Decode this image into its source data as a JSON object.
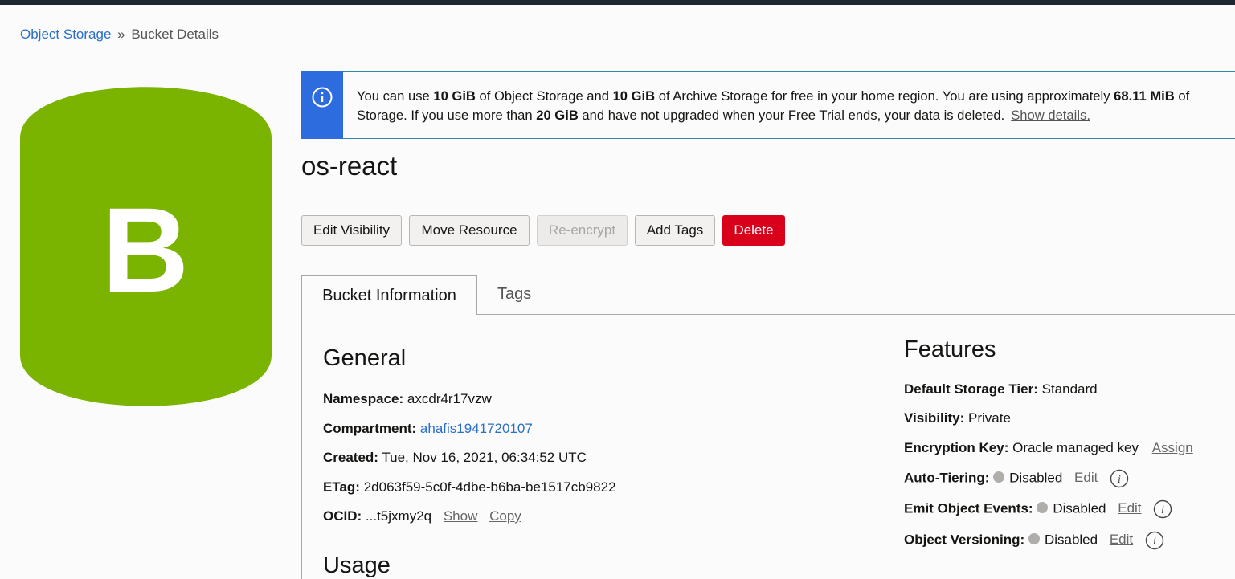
{
  "breadcrumb": {
    "root": "Object Storage",
    "separator": "»",
    "current": "Bucket Details"
  },
  "icon": {
    "letter": "B",
    "color": "#7ab300",
    "name": "bucket-icon"
  },
  "banner": {
    "p1": "You can use ",
    "b1": "10 GiB",
    "p2": " of Object Storage and ",
    "b2": "10 GiB",
    "p3": " of Archive Storage for free in your home region. You are using approximately ",
    "b3": "68.11 MiB",
    "p4": " of",
    "p5": "Storage. If you use more than ",
    "b4": "20 GiB",
    "p6": " and have not upgraded when your Free Trial ends, your data is deleted.",
    "link": "Show details."
  },
  "title": "os-react",
  "actions": {
    "edit_visibility": "Edit Visibility",
    "move_resource": "Move Resource",
    "re_encrypt": "Re-encrypt",
    "add_tags": "Add Tags",
    "delete": "Delete"
  },
  "tabs": {
    "bucket_information": "Bucket Information",
    "tags": "Tags"
  },
  "general": {
    "heading": "General",
    "namespace_label": "Namespace:",
    "namespace": "axcdr4r17vzw",
    "compartment_label": "Compartment:",
    "compartment": "ahafis1941720107",
    "created_label": "Created:",
    "created": "Tue, Nov 16, 2021, 06:34:52 UTC",
    "etag_label": "ETag:",
    "etag": "2d063f59-5c0f-4dbe-b6ba-be1517cb9822",
    "ocid_label": "OCID:",
    "ocid": "...t5jxmy2q",
    "show": "Show",
    "copy": "Copy"
  },
  "usage": {
    "heading": "Usage"
  },
  "features": {
    "heading": "Features",
    "tier_label": "Default Storage Tier:",
    "tier": "Standard",
    "visibility_label": "Visibility:",
    "visibility": "Private",
    "encryption_label": "Encryption Key:",
    "encryption": "Oracle managed key",
    "assign": "Assign",
    "autotiering_label": "Auto-Tiering:",
    "autotiering": "Disabled",
    "events_label": "Emit Object Events:",
    "events": "Disabled",
    "versioning_label": "Object Versioning:",
    "versioning": "Disabled",
    "edit": "Edit"
  },
  "colors": {
    "danger": "#d9001b",
    "info_bar": "#2d6cdf",
    "link": "#2a6fc9"
  }
}
